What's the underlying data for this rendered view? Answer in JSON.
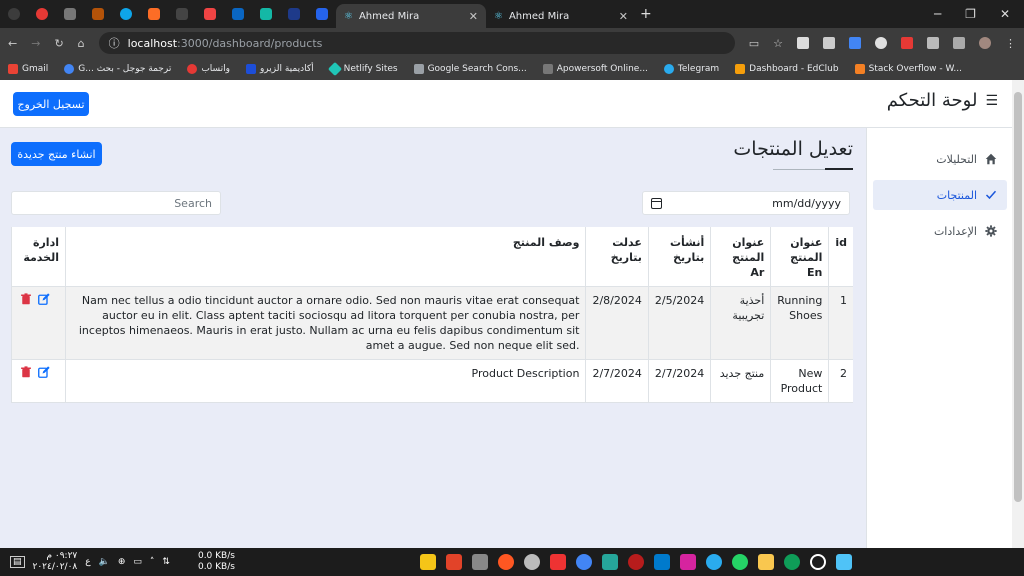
{
  "browser": {
    "tabs": [
      {
        "title": "Ahmed Mira",
        "active": true
      },
      {
        "title": "Ahmed Mira",
        "active": false
      }
    ],
    "url_host": "localhost",
    "url_path": ":3000/dashboard/products",
    "bookmarks": [
      "Gmail",
      "G... ترجمة جوجل - بحث",
      "واتساب",
      "أكاديمية الزيرو",
      "Netlify Sites",
      "Google Search Cons...",
      "Apowersoft Online...",
      "Telegram",
      "Dashboard - EdClub",
      "Stack Overflow - W..."
    ]
  },
  "header": {
    "brand": "لوحة التحكم",
    "logout_label": "تسجيل الخروج"
  },
  "sidebar": {
    "items": [
      {
        "label": "التحليلات",
        "icon": "home-icon"
      },
      {
        "label": "المنتجات",
        "icon": "check-icon",
        "active": true
      },
      {
        "label": "الإعدادات",
        "icon": "gear-icon"
      }
    ]
  },
  "main": {
    "title": "تعديل المنتجات",
    "create_label": "انشاء منتج جديدة",
    "search_placeholder": "Search",
    "date_placeholder": "mm/dd/yyyy",
    "columns": [
      "id",
      "عنوان المنتج En",
      "عنوان المنتج Ar",
      "أنشأت بتاريخ",
      "عدلت بتاريخ",
      "وصف المنتج",
      "ادارة الخدمة"
    ],
    "rows": [
      {
        "id": "1",
        "title_en": "Running Shoes",
        "title_ar": "أحذية تجريبية",
        "created": "2/5/2024",
        "updated": "2/8/2024",
        "description": "Nam nec tellus a odio tincidunt auctor a ornare odio. Sed non mauris vitae erat consequat auctor eu in elit. Class aptent taciti sociosqu ad litora torquent per conubia nostra, per inceptos himenaeos. Mauris in erat justo. Nullam ac urna eu felis dapibus condimentum sit amet a augue. Sed non neque elit sed."
      },
      {
        "id": "2",
        "title_en": "New Product",
        "title_ar": "منتج جديد",
        "created": "2/7/2024",
        "updated": "2/7/2024",
        "description": "Product Description"
      }
    ]
  },
  "taskbar": {
    "time": "٠٩:٢٧ م",
    "date": "٢٠٢٤/٠٢/٠٨",
    "lang": "ع",
    "net_up": "0.0 KB/s",
    "net_down": "0.0 KB/s"
  },
  "colors": {
    "primary": "#0d6efd",
    "danger": "#dc3545",
    "page_bg": "#e9ecf7"
  }
}
